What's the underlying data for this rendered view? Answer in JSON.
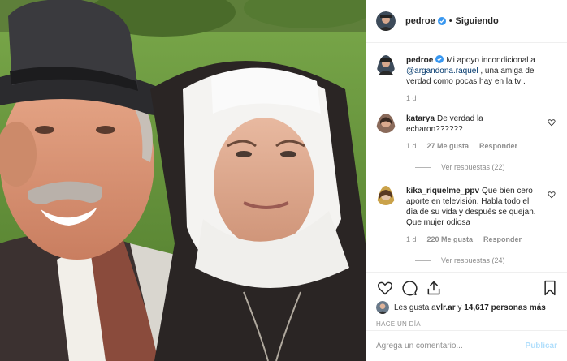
{
  "post": {
    "username": "pedroe",
    "follow_status": "Siguiendo",
    "caption_mention": "@argandona.raquel",
    "caption_prefix": "Mi apoyo incondicional a",
    "caption_suffix": " , una amiga de verdad como pocas hay en la tv .",
    "caption_time": "1 d"
  },
  "comments": [
    {
      "username": "katarya",
      "text": "De verdad la echaron??????",
      "time": "1 d",
      "likes": "27 Me gusta",
      "reply_label": "Responder",
      "view_replies": "Ver respuestas (22)"
    },
    {
      "username": "kika_riquelme_ppv",
      "text": "Que bien cero aporte en televisión. Habla todo el día de su vida y después se quejan. Que mujer odiosa",
      "time": "1 d",
      "likes": "220 Me gusta",
      "reply_label": "Responder",
      "view_replies": "Ver respuestas (24)"
    }
  ],
  "likes": {
    "prefix": "Les gusta a ",
    "user": "vlr.ar",
    "middle": " y ",
    "count": "14,617 personas más"
  },
  "time_ago": "Hace un día",
  "comment_box": {
    "placeholder": "Agrega un comentario...",
    "publish_label": "Publicar"
  },
  "icons": {
    "like": "heart-icon",
    "comment": "comment-icon",
    "share": "share-icon",
    "save": "bookmark-icon",
    "verified": "verified-badge-icon"
  },
  "colors": {
    "verified": "#3897f0",
    "link": "#00376b",
    "muted": "#8e8e8e",
    "publish_disabled": "#b2dffc"
  }
}
